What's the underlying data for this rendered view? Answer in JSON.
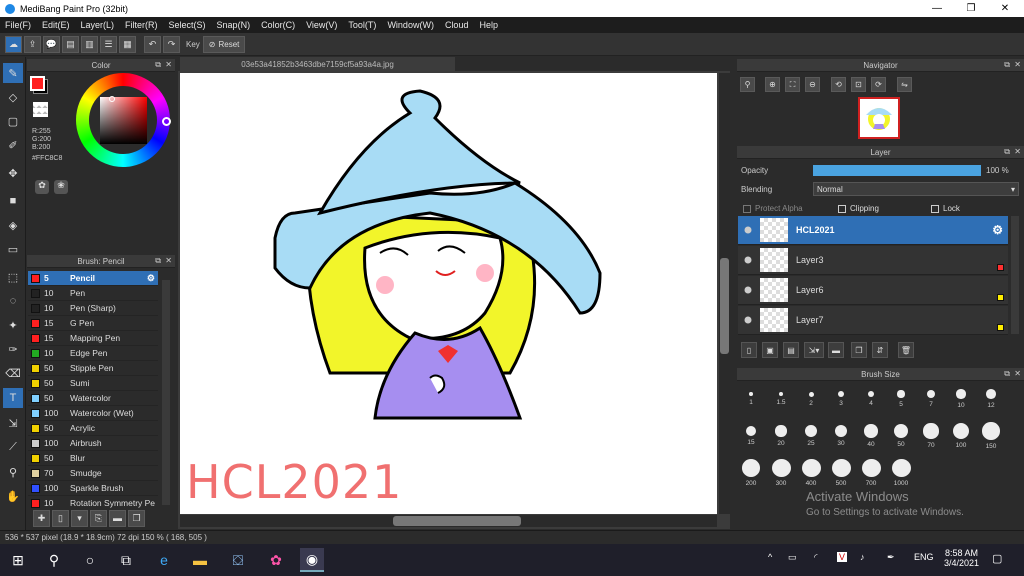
{
  "window": {
    "title": "MediBang Paint Pro (32bit)"
  },
  "menu": [
    "File(F)",
    "Edit(E)",
    "Layer(L)",
    "Filter(R)",
    "Select(S)",
    "Snap(N)",
    "Color(C)",
    "View(V)",
    "Tool(T)",
    "Window(W)",
    "Cloud",
    "Help"
  ],
  "toolbar": {
    "key_label": "Key",
    "reset_label": "Reset"
  },
  "color_panel": {
    "title": "Color",
    "r": "R:255",
    "g": "G:200",
    "b": "B:200",
    "hex": "#FFC8C8",
    "foreground": "#ff2020",
    "background": "#000000"
  },
  "brush_panel": {
    "title": "Brush: Pencil",
    "items": [
      {
        "size": "5",
        "name": "Pencil",
        "color": "#ff2020"
      },
      {
        "size": "10",
        "name": "Pen",
        "color": "#222222"
      },
      {
        "size": "10",
        "name": "Pen (Sharp)",
        "color": "#222222"
      },
      {
        "size": "15",
        "name": "G Pen",
        "color": "#ff2020"
      },
      {
        "size": "15",
        "name": "Mapping Pen",
        "color": "#ff2020"
      },
      {
        "size": "10",
        "name": "Edge Pen",
        "color": "#22aa22"
      },
      {
        "size": "50",
        "name": "Stipple Pen",
        "color": "#f0d000"
      },
      {
        "size": "50",
        "name": "Sumi",
        "color": "#f0d000"
      },
      {
        "size": "50",
        "name": "Watercolor",
        "color": "#80d0ff"
      },
      {
        "size": "100",
        "name": "Watercolor (Wet)",
        "color": "#80d0ff"
      },
      {
        "size": "50",
        "name": "Acrylic",
        "color": "#f0d000"
      },
      {
        "size": "100",
        "name": "Airbrush",
        "color": "#cccccc"
      },
      {
        "size": "50",
        "name": "Blur",
        "color": "#f0d000"
      },
      {
        "size": "70",
        "name": "Smudge",
        "color": "#e0d0a0"
      },
      {
        "size": "100",
        "name": "Sparkle Brush",
        "color": "#3050ff"
      },
      {
        "size": "10",
        "name": "Rotation Symmetry Pe",
        "color": "#ff2020"
      }
    ]
  },
  "document": {
    "tab": "03e53a41852b3463dbe7159cf5a93a4a.jpg",
    "canvas_text": "HCL2021"
  },
  "navigator": {
    "title": "Navigator"
  },
  "layer_panel": {
    "title": "Layer",
    "opacity_label": "Opacity",
    "opacity_value": "100 %",
    "opacity": 1.0,
    "blending_label": "Blending",
    "blending_value": "Normal",
    "protect_alpha": "Protect Alpha",
    "clipping": "Clipping",
    "lock": "Lock",
    "layers": [
      {
        "name": "HCL2021",
        "mark": ""
      },
      {
        "name": "Layer3",
        "mark": "#ff3030"
      },
      {
        "name": "Layer6",
        "mark": "#ffee00"
      },
      {
        "name": "Layer7",
        "mark": "#ffee00"
      }
    ]
  },
  "brush_size": {
    "title": "Brush Size",
    "sizes": [
      "1",
      "1.5",
      "2",
      "3",
      "4",
      "5",
      "7",
      "10",
      "12",
      "15",
      "20",
      "25",
      "30",
      "40",
      "50",
      "70",
      "100",
      "150",
      "200",
      "300",
      "400",
      "500",
      "700",
      "1000"
    ]
  },
  "status": {
    "text": "536 * 537 pixel  (18.9 * 18.9cm)   72 dpi   150 %   ( 168, 505 )"
  },
  "watermark": {
    "line1": "Activate Windows",
    "line2": "Go to Settings to activate Windows."
  },
  "taskbar": {
    "lang": "ENG",
    "time": "8:58 AM",
    "date": "3/4/2021"
  }
}
